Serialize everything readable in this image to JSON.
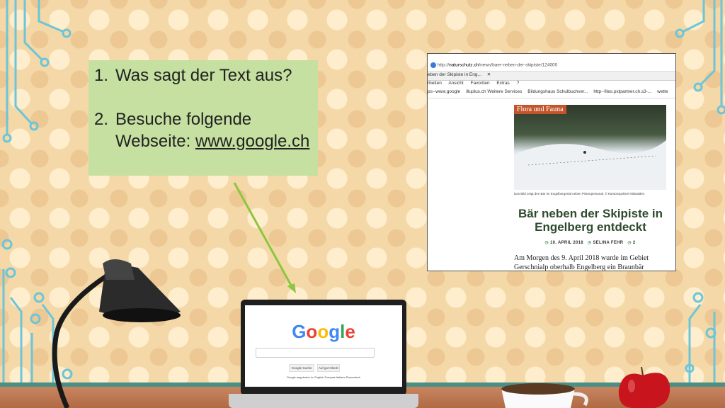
{
  "task_box": {
    "items": [
      {
        "num": "1.",
        "text": "Was sagt der Text aus?"
      },
      {
        "num": "2.",
        "text": "Besuche folgende Webseite: ",
        "link": "www.google.ch"
      }
    ]
  },
  "browser_screenshot": {
    "address_url_prefix": "http://",
    "address_url_domain": "naturschutz.ch",
    "address_url_path": "/news/baer-neben-der-skipiste/124000",
    "tab_title": "eben der Skipiste in Eng...",
    "tab_close": "✕",
    "menu": [
      "rbeiten",
      "Ansicht",
      "Favoriten",
      "Extras",
      "?"
    ],
    "favorites": [
      "ps--www.google",
      "illuplus.ch Weitere Services",
      "Bildungshaus Schulbuchver...",
      "http--files.pxlpartner.ch.s3-...",
      "wette"
    ],
    "category_tag": "Flora und Fauna",
    "photo_caption": "Das Bild zeigt den Bär im Engelbergertal neben Pistenpersonal. © Kantonspolizei Nidwalden",
    "headline": "Bär neben der Skipiste in Engelberg entdeckt",
    "date": "10. APRIL 2018",
    "author": "SELINA FEHR",
    "comments": "2",
    "body": "Am Morgen des 9. April 2018 wurde im Gebiet Gerschnialp oberhalb Engelberg ein Braunbär"
  },
  "laptop": {
    "logo_letters": [
      {
        "ch": "G",
        "color": "#4285F4"
      },
      {
        "ch": "o",
        "color": "#EA4335"
      },
      {
        "ch": "o",
        "color": "#FBBC05"
      },
      {
        "ch": "g",
        "color": "#4285F4"
      },
      {
        "ch": "l",
        "color": "#34A853"
      },
      {
        "ch": "e",
        "color": "#EA4335"
      }
    ],
    "search_button": "Google-Suche",
    "lucky_button": "Auf gut Glück!",
    "footer": "Google angeboten in:  English  Français  Italiano  Rumantsch"
  },
  "colors": {
    "task_box": "#c5e0a0",
    "arrow": "#8cc63f",
    "circuit": "#6cc5d8",
    "headline": "#2e4a2e",
    "category_tag": "#c4552a"
  }
}
